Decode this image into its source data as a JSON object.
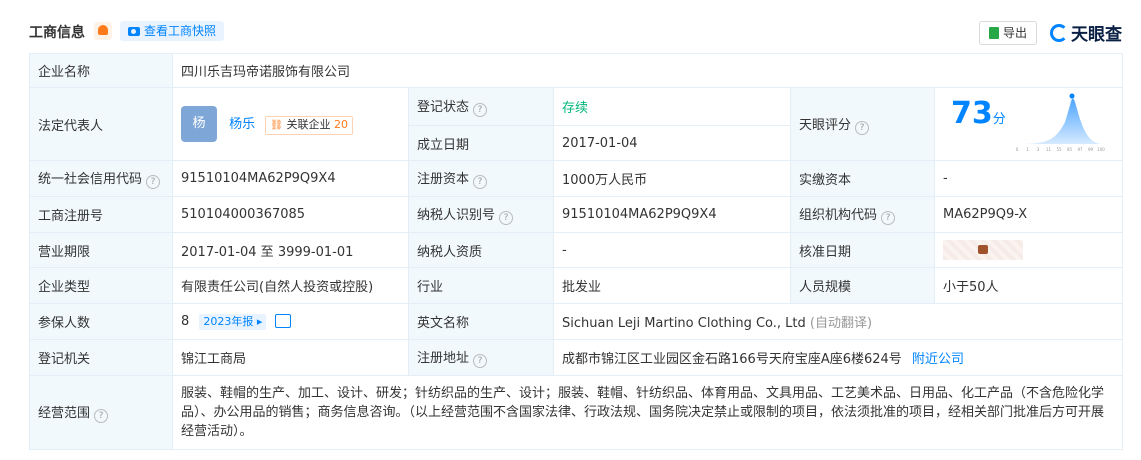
{
  "header": {
    "title": "工商信息",
    "snapshot_label": "查看工商快照",
    "export_label": "导出",
    "logo_text": "天眼查"
  },
  "company": {
    "name_label": "企业名称",
    "name": "四川乐吉玛帝诺服饰有限公司",
    "rep_label": "法定代表人",
    "rep_avatar": "杨",
    "rep_name": "杨乐",
    "rep_related_label": "关联企业",
    "rep_related_count": "20",
    "status_label": "登记状态",
    "status": "存续",
    "founded_label": "成立日期",
    "founded": "2017-01-04",
    "score_label": "天眼评分",
    "score": "73",
    "score_unit": "分",
    "score_axis": [
      "0",
      "1",
      "3",
      "11",
      "55",
      "85",
      "97",
      "99",
      "100"
    ],
    "credit_code_label": "统一社会信用代码",
    "credit_code": "91510104MA62P9Q9X4",
    "reg_capital_label": "注册资本",
    "reg_capital": "1000万人民币",
    "paid_capital_label": "实缴资本",
    "paid_capital": "-",
    "reg_no_label": "工商注册号",
    "reg_no": "510104000367085",
    "taxpayer_id_label": "纳税人识别号",
    "taxpayer_id": "91510104MA62P9Q9X4",
    "org_code_label": "组织机构代码",
    "org_code": "MA62P9Q9-X",
    "term_label": "营业期限",
    "term": "2017-01-04 至 3999-01-01",
    "taxpayer_qual_label": "纳税人资质",
    "taxpayer_qual": "-",
    "approval_date_label": "核准日期",
    "type_label": "企业类型",
    "type": "有限责任公司(自然人投资或控股)",
    "industry_label": "行业",
    "industry": "批发业",
    "staff_label": "人员规模",
    "staff": "小于50人",
    "insured_label": "参保人数",
    "insured": "8",
    "insured_year": "2023年报",
    "en_name_label": "英文名称",
    "en_name": "Sichuan Leji Martino Clothing Co., Ltd",
    "en_name_note": "(自动翻译)",
    "authority_label": "登记机关",
    "authority": "锦江工商局",
    "address_label": "注册地址",
    "address": "成都市锦江区工业园区金石路166号天府宝座A座6楼624号",
    "nearby_label": "附近公司",
    "scope_label": "经营范围",
    "scope": "服装、鞋帽的生产、加工、设计、研发；针纺织品的生产、设计；服装、鞋帽、针纺织品、体育用品、文具用品、工艺美术品、日用品、化工产品（不含危险化学品）、办公用品的销售；商务信息咨询。（以上经营范围不含国家法律、行政法规、国务院决定禁止或限制的项目，依法须批准的项目，经相关部门批准后方可开展经营活动）。"
  }
}
